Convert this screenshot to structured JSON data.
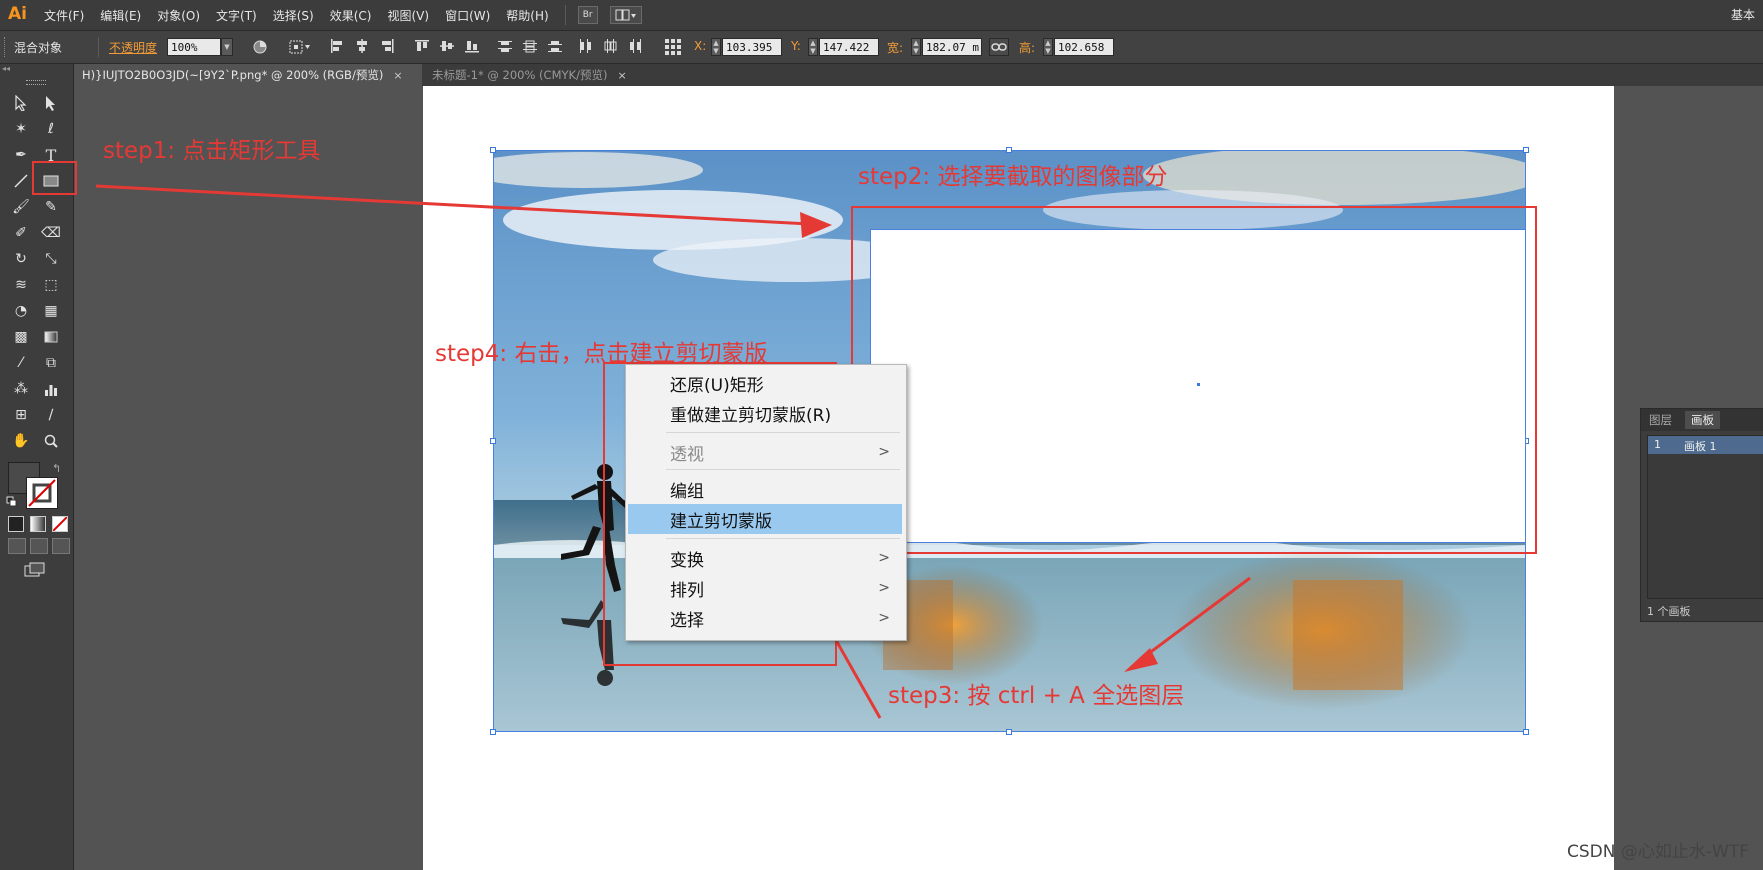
{
  "app": {
    "logo": "Ai",
    "menus": [
      "文件(F)",
      "编辑(E)",
      "对象(O)",
      "文字(T)",
      "选择(S)",
      "效果(C)",
      "视图(V)",
      "窗口(W)",
      "帮助(H)"
    ],
    "bridge_button": "Br",
    "workspace": "基本"
  },
  "control_bar": {
    "selection_label": "混合对象",
    "opacity_label": "不透明度",
    "opacity_value": "100%",
    "x_label": "X:",
    "x_value": "103.395",
    "y_label": "Y:",
    "y_value": "147.422",
    "w_label": "宽:",
    "w_value": "182.07 m",
    "h_label": "高:",
    "h_value": "102.658"
  },
  "tabs": [
    {
      "label": "H)}IUJTO2B0O3JD(~[9Y2`P.png* @ 200% (RGB/预览)",
      "close": "×"
    },
    {
      "label": "未标题-1* @ 200% (CMYK/预览)",
      "close": "×"
    }
  ],
  "context_menu": {
    "items": [
      {
        "label": "还原(U)矩形",
        "state": "normal",
        "submenu": false
      },
      {
        "label": "重做建立剪切蒙版(R)",
        "state": "normal",
        "submenu": false
      },
      {
        "label": "透视",
        "state": "disabled",
        "submenu": true
      },
      {
        "label": "编组",
        "state": "normal",
        "submenu": false
      },
      {
        "label": "建立剪切蒙版",
        "state": "highlighted",
        "submenu": false
      },
      {
        "label": "变换",
        "state": "normal",
        "submenu": true
      },
      {
        "label": "排列",
        "state": "normal",
        "submenu": true
      },
      {
        "label": "选择",
        "state": "normal",
        "submenu": true
      }
    ],
    "submenu_arrow": ">"
  },
  "annotations": {
    "step1": "step1: 点击矩形工具",
    "step2": "step2: 选择要截取的图像部分",
    "step3": "step3: 按 ctrl + A 全选图层",
    "step4": "step4: 右击，点击建立剪切蒙版"
  },
  "layers_panel": {
    "tabs": [
      "图层",
      "画板"
    ],
    "row_number": "1",
    "row_name": "画板 1",
    "footer": "1 个画板"
  },
  "watermark": "CSDN @心如止水-WTF",
  "colors": {
    "annotation_red": "#e53935",
    "menu_highlight": "#99c9ef",
    "selection_blue": "#3a7ae0",
    "ai_orange": "#f7941d"
  }
}
